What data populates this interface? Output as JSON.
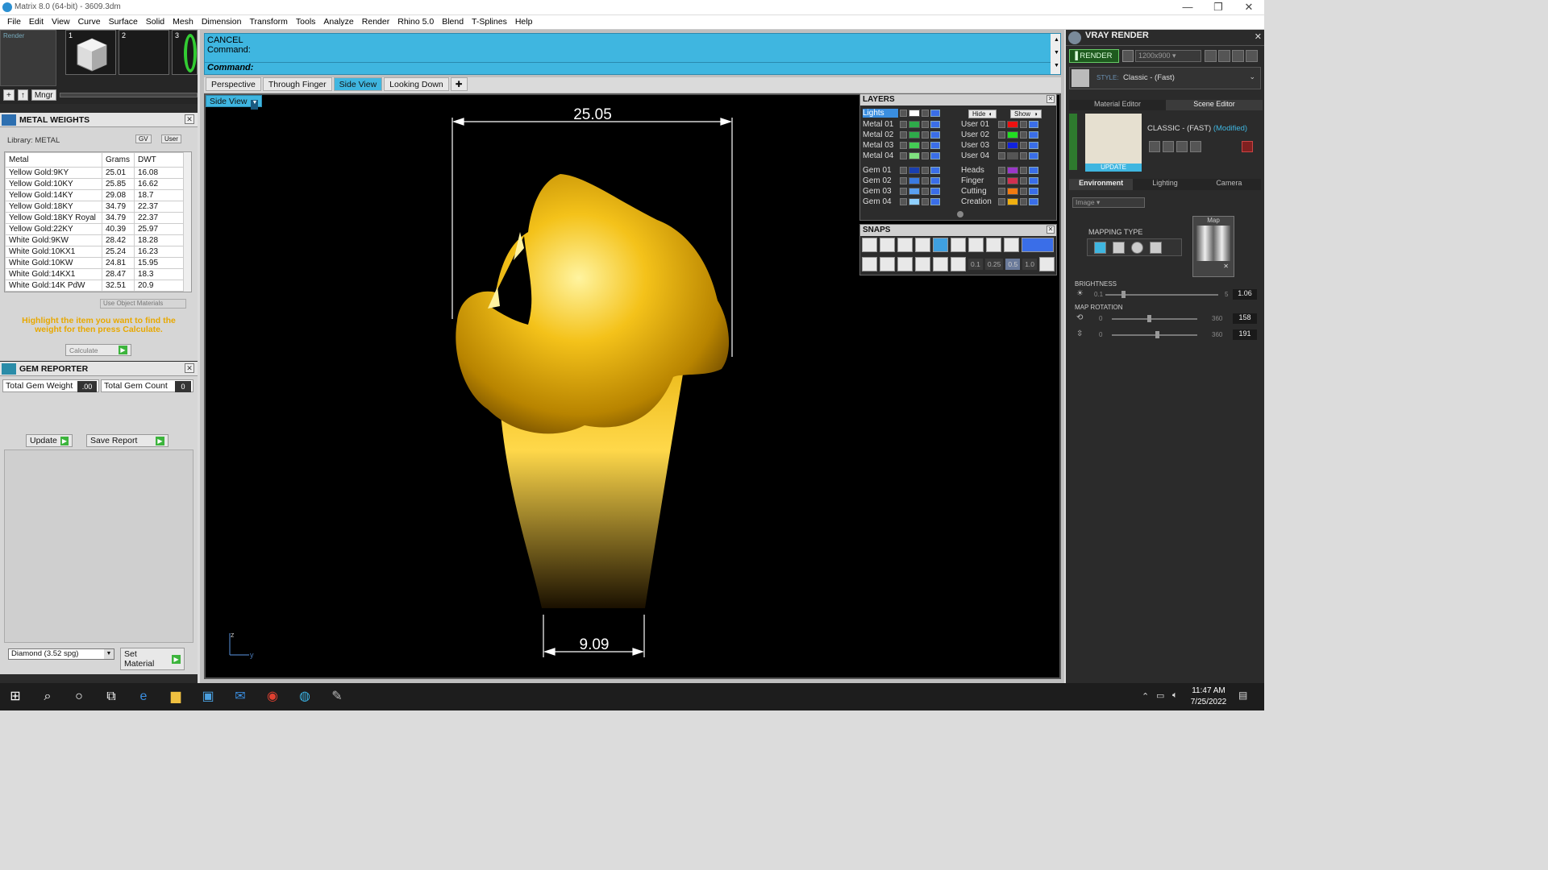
{
  "window": {
    "title": "Matrix 8.0 (64-bit) - 3609.3dm"
  },
  "menu": [
    "File",
    "Edit",
    "View",
    "Curve",
    "Surface",
    "Solid",
    "Mesh",
    "Dimension",
    "Transform",
    "Tools",
    "Analyze",
    "Render",
    "Rhino 5.0",
    "Blend",
    "T-Splines",
    "Help"
  ],
  "thumbs": {
    "labels": [
      "1",
      "2",
      "3"
    ],
    "top_left_label": "Render",
    "mngr": "Mngr"
  },
  "metal_weights": {
    "title": "METAL WEIGHTS",
    "library": "Library: METAL",
    "gv": "GV",
    "user": "User",
    "columns": [
      "Metal",
      "Grams",
      "DWT"
    ],
    "rows": [
      [
        "Yellow Gold:9KY",
        "25.01",
        "16.08"
      ],
      [
        "Yellow Gold:10KY",
        "25.85",
        "16.62"
      ],
      [
        "Yellow Gold:14KY",
        "29.08",
        "18.7"
      ],
      [
        "Yellow Gold:18KY",
        "34.79",
        "22.37"
      ],
      [
        "Yellow Gold:18KY Royal",
        "34.79",
        "22.37"
      ],
      [
        "Yellow Gold:22KY",
        "40.39",
        "25.97"
      ],
      [
        "White Gold:9KW",
        "28.42",
        "18.28"
      ],
      [
        "White Gold:10KX1",
        "25.24",
        "16.23"
      ],
      [
        "White Gold:10KW",
        "24.81",
        "15.95"
      ],
      [
        "White Gold:14KX1",
        "28.47",
        "18.3"
      ],
      [
        "White Gold:14K PdW",
        "32.51",
        "20.9"
      ]
    ],
    "use_object_materials": "Use Object Materials",
    "hint": "Highlight the item you want to find the weight for then press Calculate.",
    "calculate": "Calculate"
  },
  "gem_reporter": {
    "title": "GEM REPORTER",
    "total_weight_label": "Total Gem Weight",
    "total_weight_value": ".00",
    "total_count_label": "Total Gem Count",
    "total_count_value": "0",
    "update": "Update",
    "save_report": "Save Report",
    "gem_select": "Diamond    (3.52 spg)",
    "set_material": "Set Material"
  },
  "command": {
    "line1": "CANCEL",
    "line2": "Command:",
    "prompt": "Command:"
  },
  "view_tabs": [
    "Perspective",
    "Through Finger",
    "Side View",
    "Looking Down"
  ],
  "active_tab": "Side View",
  "viewport": {
    "label": "Side View",
    "dim_top": "25.05",
    "dim_bottom": "9.09",
    "axis_z": "z",
    "axis_y": "y"
  },
  "layers": {
    "title": "LAYERS",
    "hide": "Hide",
    "show": "Show",
    "left": [
      {
        "name": "Lights",
        "color": "#ffffff"
      },
      {
        "name": "Metal 01",
        "color": "#2eaa4a"
      },
      {
        "name": "Metal 02",
        "color": "#2eaa4a"
      },
      {
        "name": "Metal 03",
        "color": "#44cc55"
      },
      {
        "name": "Metal 04",
        "color": "#7fe07f"
      },
      {
        "name": "Gem 01",
        "color": "#1a3fb0"
      },
      {
        "name": "Gem 02",
        "color": "#3a7ae0"
      },
      {
        "name": "Gem 03",
        "color": "#5aa0f0"
      },
      {
        "name": "Gem 04",
        "color": "#8fd0ff"
      }
    ],
    "right": [
      {
        "name": "User 01",
        "color": "#ee1111"
      },
      {
        "name": "User 02",
        "color": "#22dd22"
      },
      {
        "name": "User 03",
        "color": "#1122dd"
      },
      {
        "name": "User 04",
        "color": "#555555"
      },
      {
        "name": "Heads",
        "color": "#9a38c8"
      },
      {
        "name": "Finger",
        "color": "#d03050"
      },
      {
        "name": "Cutting",
        "color": "#f07a10"
      },
      {
        "name": "Creation",
        "color": "#f0b010"
      }
    ]
  },
  "snaps": {
    "title": "SNAPS",
    "values": [
      "0.1",
      "0.25",
      "0.5",
      "1.0"
    ]
  },
  "vray": {
    "title": "VRAY RENDER",
    "render": "RENDER",
    "resolution": "1200x900",
    "style_label": "STYLE:",
    "style_value": "Classic - (Fast)",
    "tab_material": "Material Editor",
    "tab_scene": "Scene Editor",
    "preset_name": "CLASSIC - (FAST)",
    "modified": "(Modified)",
    "update": "UPDATE",
    "subtabs": [
      "Environment",
      "Lighting",
      "Camera"
    ],
    "env_type": "Image",
    "mapping_type": "MAPPING TYPE",
    "map": "Map",
    "brightness_label": "BRIGHTNESS",
    "brightness_min": "0.1",
    "brightness_max": "5",
    "brightness_value": "1.06",
    "rotation_label": "MAP ROTATION",
    "rot1_min": "0",
    "rot1_max": "360",
    "rot1_value": "158",
    "rot2_min": "0",
    "rot2_max": "360",
    "rot2_value": "191"
  },
  "taskbar": {
    "time": "11:47 AM",
    "date": "7/25/2022"
  }
}
